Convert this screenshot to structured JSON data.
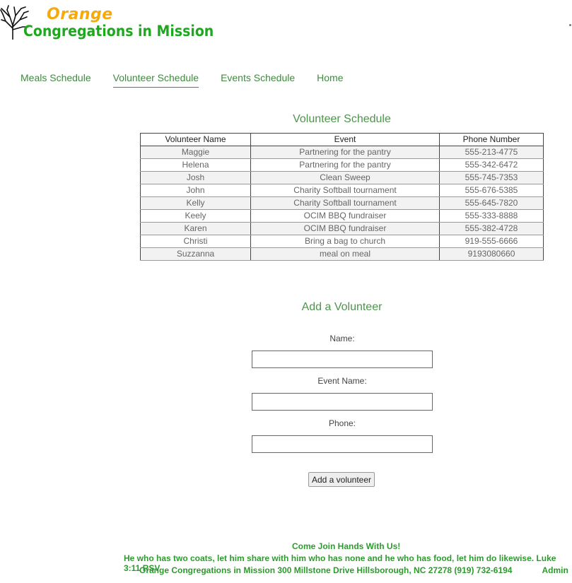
{
  "brand": {
    "word1": "Orange",
    "word2": "Congregations in Mission",
    "colors": {
      "orange": "#f5a90a",
      "green": "#1fa81f"
    },
    "icon": "tree-icon"
  },
  "nav": {
    "items": [
      {
        "label": "Meals Schedule"
      },
      {
        "label": "Volunteer Schedule",
        "active": true
      },
      {
        "label": "Events Schedule"
      },
      {
        "label": "Home"
      }
    ]
  },
  "schedule": {
    "title": "Volunteer Schedule",
    "columns": [
      "Volunteer Name",
      "Event",
      "Phone Number"
    ],
    "rows": [
      [
        "Maggie",
        "Partnering for the pantry",
        "555-213-4775"
      ],
      [
        "Helena",
        "Partnering for the pantry",
        "555-342-6472"
      ],
      [
        "Josh",
        "Clean Sweep",
        "555-745-7353"
      ],
      [
        "John",
        "Charity Softball tournament",
        "555-676-5385"
      ],
      [
        "Kelly",
        "Charity Softball tournament",
        "555-645-7820"
      ],
      [
        "Keely",
        "OCIM BBQ fundraiser",
        "555-333-8888"
      ],
      [
        "Karen",
        "OCIM BBQ fundraiser",
        "555-382-4728"
      ],
      [
        "Christi",
        "Bring a bag to church",
        "919-555-6666"
      ],
      [
        "Suzzanna",
        "meal on meal",
        "9193080660"
      ]
    ]
  },
  "form": {
    "title": "Add a Volunteer",
    "name_label": "Name:",
    "name_value": "",
    "event_label": "Event Name:",
    "event_value": "",
    "phone_label": "Phone:",
    "phone_value": "",
    "submit_label": "Add a volunteer"
  },
  "footer": {
    "line1": "Come Join Hands With Us!",
    "line2": "He who has two coats, let him share with him who has none and he who has food, let him do likewise. Luke 3:11 RSV",
    "line3": "Orange Congregations in Mission 300 Millstone Drive Hillsborough, NC 27278 (919) 732-6194",
    "admin_label": "Admin"
  },
  "colors": {
    "nav_green": "#3f8a3f",
    "heading_green": "#4d944d",
    "footer_green": "#2e9a2e"
  }
}
